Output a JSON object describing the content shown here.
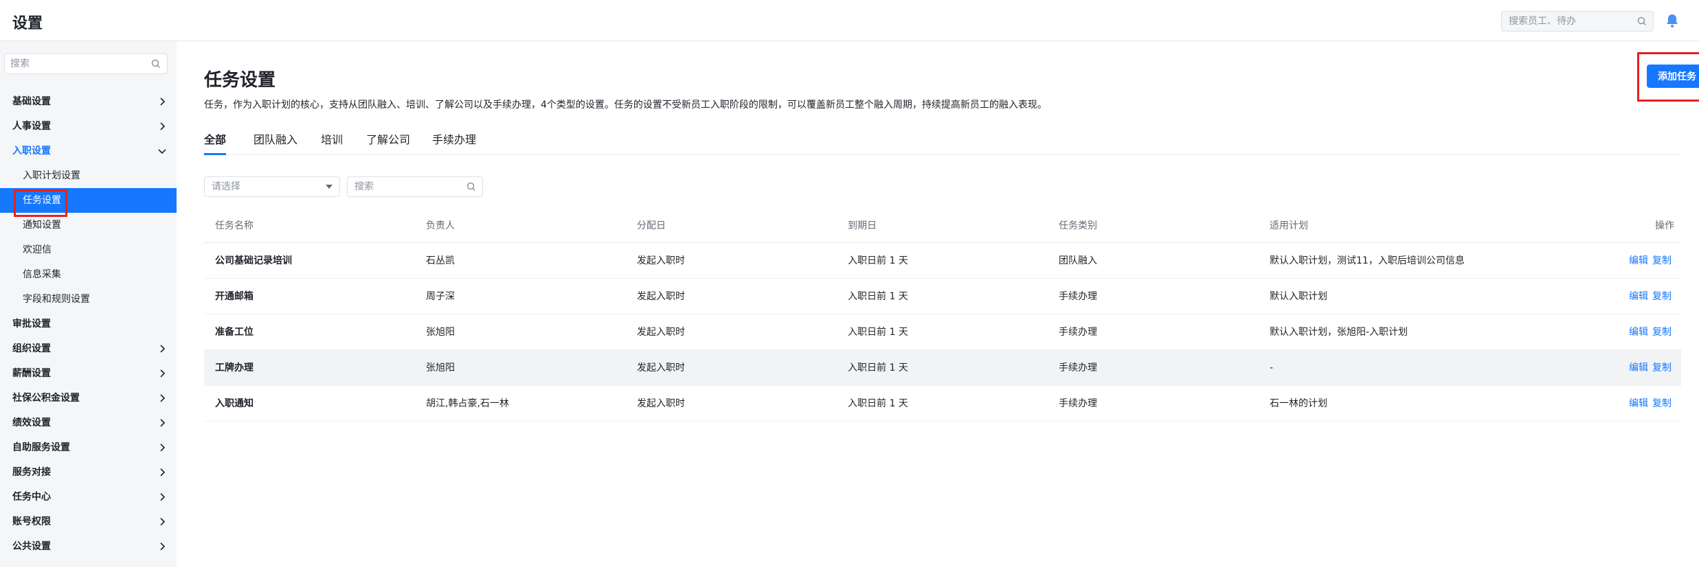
{
  "app": {
    "title": "设置"
  },
  "header": {
    "search_placeholder": "搜索员工、待办"
  },
  "sidebar": {
    "search_placeholder": "搜索",
    "items": [
      {
        "label": "基础设置",
        "type": "group"
      },
      {
        "label": "人事设置",
        "type": "group"
      },
      {
        "label": "入职设置",
        "type": "group-open"
      },
      {
        "label": "入职计划设置",
        "type": "sub"
      },
      {
        "label": "任务设置",
        "type": "sub-active"
      },
      {
        "label": "通知设置",
        "type": "sub"
      },
      {
        "label": "欢迎信",
        "type": "sub"
      },
      {
        "label": "信息采集",
        "type": "sub"
      },
      {
        "label": "字段和规则设置",
        "type": "sub"
      },
      {
        "label": "审批设置",
        "type": "group-nochev"
      },
      {
        "label": "组织设置",
        "type": "group"
      },
      {
        "label": "薪酬设置",
        "type": "group"
      },
      {
        "label": "社保公积金设置",
        "type": "group"
      },
      {
        "label": "绩效设置",
        "type": "group"
      },
      {
        "label": "自助服务设置",
        "type": "group"
      },
      {
        "label": "服务对接",
        "type": "group"
      },
      {
        "label": "任务中心",
        "type": "group"
      },
      {
        "label": "账号权限",
        "type": "group"
      },
      {
        "label": "公共设置",
        "type": "group"
      }
    ]
  },
  "main": {
    "title": "任务设置",
    "description": "任务，作为入职计划的核心，支持从团队融入、培训、了解公司以及手续办理，4个类型的设置。任务的设置不受新员工入职阶段的限制，可以覆盖新员工整个融入周期，持续提高新员工的融入表现。",
    "add_button": "添加任务",
    "tabs": [
      "全部",
      "团队融入",
      "培训",
      "了解公司",
      "手续办理"
    ],
    "filter_select_placeholder": "请选择",
    "filter_search_placeholder": "搜索"
  },
  "table": {
    "columns": [
      "任务名称",
      "负责人",
      "分配日",
      "到期日",
      "任务类别",
      "适用计划",
      "操作"
    ],
    "rows": [
      {
        "name": "公司基础记录培训",
        "owner": "石丛凯",
        "assign": "发起入职时",
        "due": "入职日前 1 天",
        "category": "团队融入",
        "plan": "默认入职计划，测试11，入职后培训公司信息",
        "edit": "编辑",
        "copy": "复制"
      },
      {
        "name": "开通邮箱",
        "owner": "周子深",
        "assign": "发起入职时",
        "due": "入职日前 1 天",
        "category": "手续办理",
        "plan": "默认入职计划",
        "edit": "编辑",
        "copy": "复制"
      },
      {
        "name": "准备工位",
        "owner": "张旭阳",
        "assign": "发起入职时",
        "due": "入职日前 1 天",
        "category": "手续办理",
        "plan": "默认入职计划，张旭阳-入职计划",
        "edit": "编辑",
        "copy": "复制"
      },
      {
        "name": "工牌办理",
        "owner": "张旭阳",
        "assign": "发起入职时",
        "due": "入职日前 1 天",
        "category": "手续办理",
        "plan": "-",
        "edit": "编辑",
        "copy": "复制"
      },
      {
        "name": "入职通知",
        "owner": "胡江,韩占豪,石一林",
        "assign": "发起入职时",
        "due": "入职日前 1 天",
        "category": "手续办理",
        "plan": "石一林的计划",
        "edit": "编辑",
        "copy": "复制"
      }
    ]
  },
  "colors": {
    "accent": "#1677ff",
    "highlight": "#e52121",
    "sidebar_bg": "#f5f6f7"
  }
}
